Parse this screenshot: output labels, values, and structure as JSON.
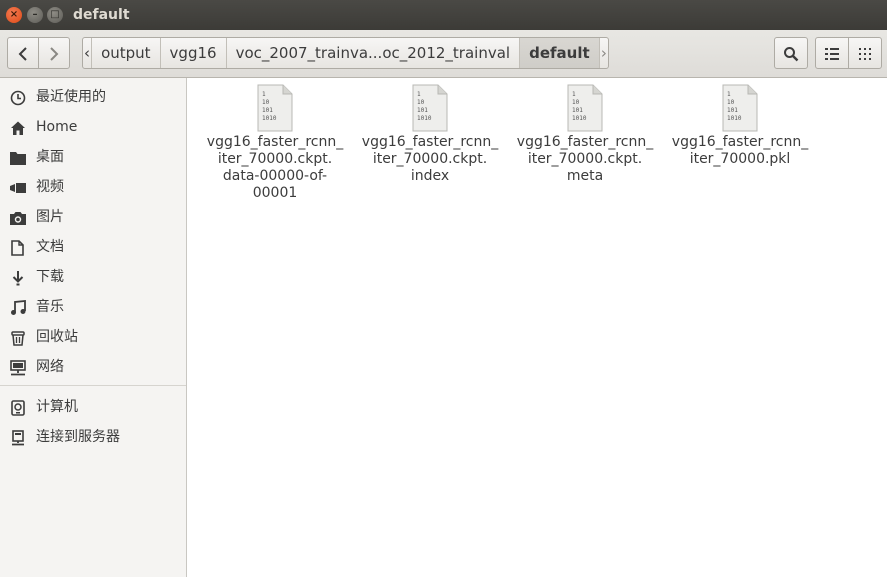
{
  "window": {
    "title": "default"
  },
  "titlebar": {
    "close_glyph": "×",
    "min_glyph": "–",
    "max_glyph": "□"
  },
  "toolbar": {
    "back_icon": "chevron-left-icon",
    "forward_icon": "chevron-right-icon",
    "path": {
      "left_arrow": "‹",
      "crumbs": [
        "output",
        "vgg16",
        "voc_2007_trainva...oc_2012_trainval",
        "default"
      ],
      "right_arrow": "›"
    },
    "search_icon": "search-icon",
    "list_view_icon": "list-view-icon",
    "grid_view_icon": "grid-view-icon"
  },
  "sidebar": {
    "items": [
      {
        "label": "最近使用的",
        "icon": "clock-icon"
      },
      {
        "label": "Home",
        "icon": "home-icon"
      },
      {
        "label": "桌面",
        "icon": "folder-icon"
      },
      {
        "label": "视频",
        "icon": "video-icon"
      },
      {
        "label": "图片",
        "icon": "camera-icon"
      },
      {
        "label": "文档",
        "icon": "document-icon"
      },
      {
        "label": "下载",
        "icon": "download-icon"
      },
      {
        "label": "音乐",
        "icon": "music-icon"
      },
      {
        "label": "回收站",
        "icon": "trash-icon"
      },
      {
        "label": "网络",
        "icon": "network-icon"
      }
    ],
    "devices": [
      {
        "label": "计算机",
        "icon": "computer-icon"
      },
      {
        "label": "连接到服务器",
        "icon": "server-icon"
      }
    ]
  },
  "files": [
    {
      "name": "vgg16_faster_rcnn_\niter_70000.ckpt.\ndata-00000-of-\n00001",
      "icon": "binary-file-icon"
    },
    {
      "name": "vgg16_faster_rcnn_\niter_70000.ckpt.\nindex",
      "icon": "binary-file-icon"
    },
    {
      "name": "vgg16_faster_rcnn_\niter_70000.ckpt.\nmeta",
      "icon": "binary-file-icon"
    },
    {
      "name": "vgg16_faster_rcnn_\niter_70000.pkl",
      "icon": "binary-file-icon"
    }
  ],
  "file_icon_text": [
    "1",
    "10",
    "101",
    "1010"
  ]
}
